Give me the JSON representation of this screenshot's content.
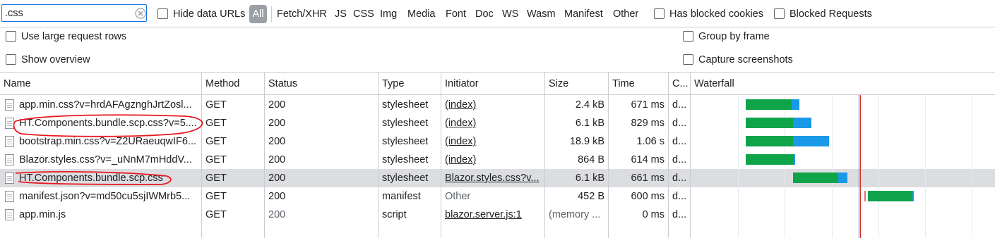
{
  "filter": {
    "value": ".css",
    "hide_data_urls": "Hide data URLs",
    "all": "All",
    "types": [
      "Fetch/XHR",
      "JS",
      "CSS",
      "Img",
      "Media",
      "Font",
      "Doc",
      "WS",
      "Wasm",
      "Manifest",
      "Other"
    ],
    "has_blocked_cookies": "Has blocked cookies",
    "blocked_requests": "Blocked Requests"
  },
  "options": {
    "large_rows": "Use large request rows",
    "show_overview": "Show overview",
    "group_by_frame": "Group by frame",
    "capture_screenshots": "Capture screenshots"
  },
  "columns": {
    "name": "Name",
    "method": "Method",
    "status": "Status",
    "type": "Type",
    "initiator": "Initiator",
    "size": "Size",
    "time": "Time",
    "cache": "C...",
    "waterfall": "Waterfall"
  },
  "rows": [
    {
      "name": "app.min.css?v=hrdAFAgznghJrtZosl...",
      "method": "GET",
      "status": "200",
      "type": "stylesheet",
      "initiator": "(index)",
      "size": "2.4 kB",
      "time": "671 ms",
      "cache": "d..."
    },
    {
      "name": "HT.Components.bundle.scp.css?v=5....",
      "method": "GET",
      "status": "200",
      "type": "stylesheet",
      "initiator": "(index)",
      "size": "6.1 kB",
      "time": "829 ms",
      "cache": "d..."
    },
    {
      "name": "bootstrap.min.css?v=Z2URaeuqwIF6...",
      "method": "GET",
      "status": "200",
      "type": "stylesheet",
      "initiator": "(index)",
      "size": "18.9 kB",
      "time": "1.06 s",
      "cache": "d..."
    },
    {
      "name": "Blazor.styles.css?v=_uNnM7mHddV...",
      "method": "GET",
      "status": "200",
      "type": "stylesheet",
      "initiator": "(index)",
      "size": "864 B",
      "time": "614 ms",
      "cache": "d..."
    },
    {
      "name": "HT.Components.bundle.scp.css",
      "method": "GET",
      "status": "200",
      "type": "stylesheet",
      "initiator": "Blazor.styles.css?v...",
      "size": "6.1 kB",
      "time": "661 ms",
      "cache": "d..."
    },
    {
      "name": "manifest.json?v=md50cu5sjIWMrb5...",
      "method": "GET",
      "status": "200",
      "type": "manifest",
      "initiator": "Other",
      "size": "452 B",
      "time": "600 ms",
      "cache": "d..."
    },
    {
      "name": "app.min.js",
      "method": "GET",
      "status": "200",
      "type": "script",
      "initiator": "blazor.server.js:1",
      "size": "(memory ...",
      "time": "0 ms",
      "cache": "d..."
    }
  ],
  "colors": {
    "accent": "#1a73e8",
    "waiting": "#0fa34a",
    "download": "#1a9ae6",
    "annotation": "#e8171d"
  }
}
